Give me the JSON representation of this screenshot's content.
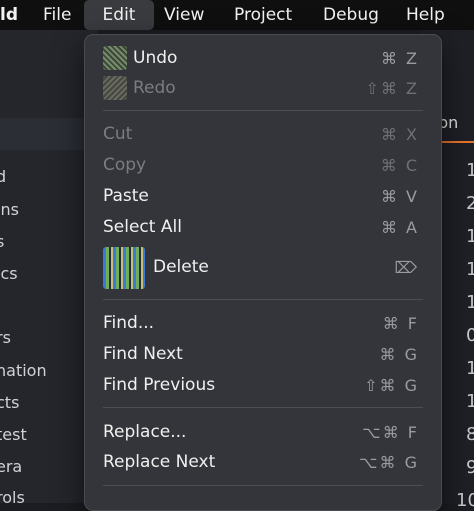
{
  "menubar": {
    "app": "ld",
    "items": [
      "File",
      "Edit",
      "View",
      "Project",
      "Debug",
      "Help"
    ]
  },
  "sidebar_partial": [
    "d",
    "ins",
    "s",
    "ics",
    "rs",
    "nation",
    "cts",
    "test",
    "era",
    "rols"
  ],
  "editor_partial": {
    "tab": "pn",
    "lines": [
      "1",
      "2",
      "1",
      "1",
      "1",
      "0",
      "1",
      "1",
      "8",
      "9",
      "10"
    ]
  },
  "menu": {
    "undo": {
      "label": "Undo",
      "shortcut": "⌘ Z"
    },
    "redo": {
      "label": "Redo",
      "shortcut": "⇧⌘ Z"
    },
    "cut": {
      "label": "Cut",
      "shortcut": "⌘ X"
    },
    "copy": {
      "label": "Copy",
      "shortcut": "⌘ C"
    },
    "paste": {
      "label": "Paste",
      "shortcut": "⌘ V"
    },
    "select_all": {
      "label": "Select All",
      "shortcut": "⌘ A"
    },
    "delete": {
      "label": "Delete",
      "shortcut": "⌦"
    },
    "find": {
      "label": "Find...",
      "shortcut": "⌘ F"
    },
    "find_next": {
      "label": "Find Next",
      "shortcut": "⌘ G"
    },
    "find_previous": {
      "label": "Find Previous",
      "shortcut": "⇧⌘ G"
    },
    "replace": {
      "label": "Replace...",
      "shortcut": "⌥⌘ F"
    },
    "replace_next": {
      "label": "Replace Next",
      "shortcut": "⌥⌘ G"
    }
  },
  "colors": {
    "menu_bg": "#34353a",
    "accent_tab": "#e8742a",
    "disabled_text": "#7b7c80"
  }
}
